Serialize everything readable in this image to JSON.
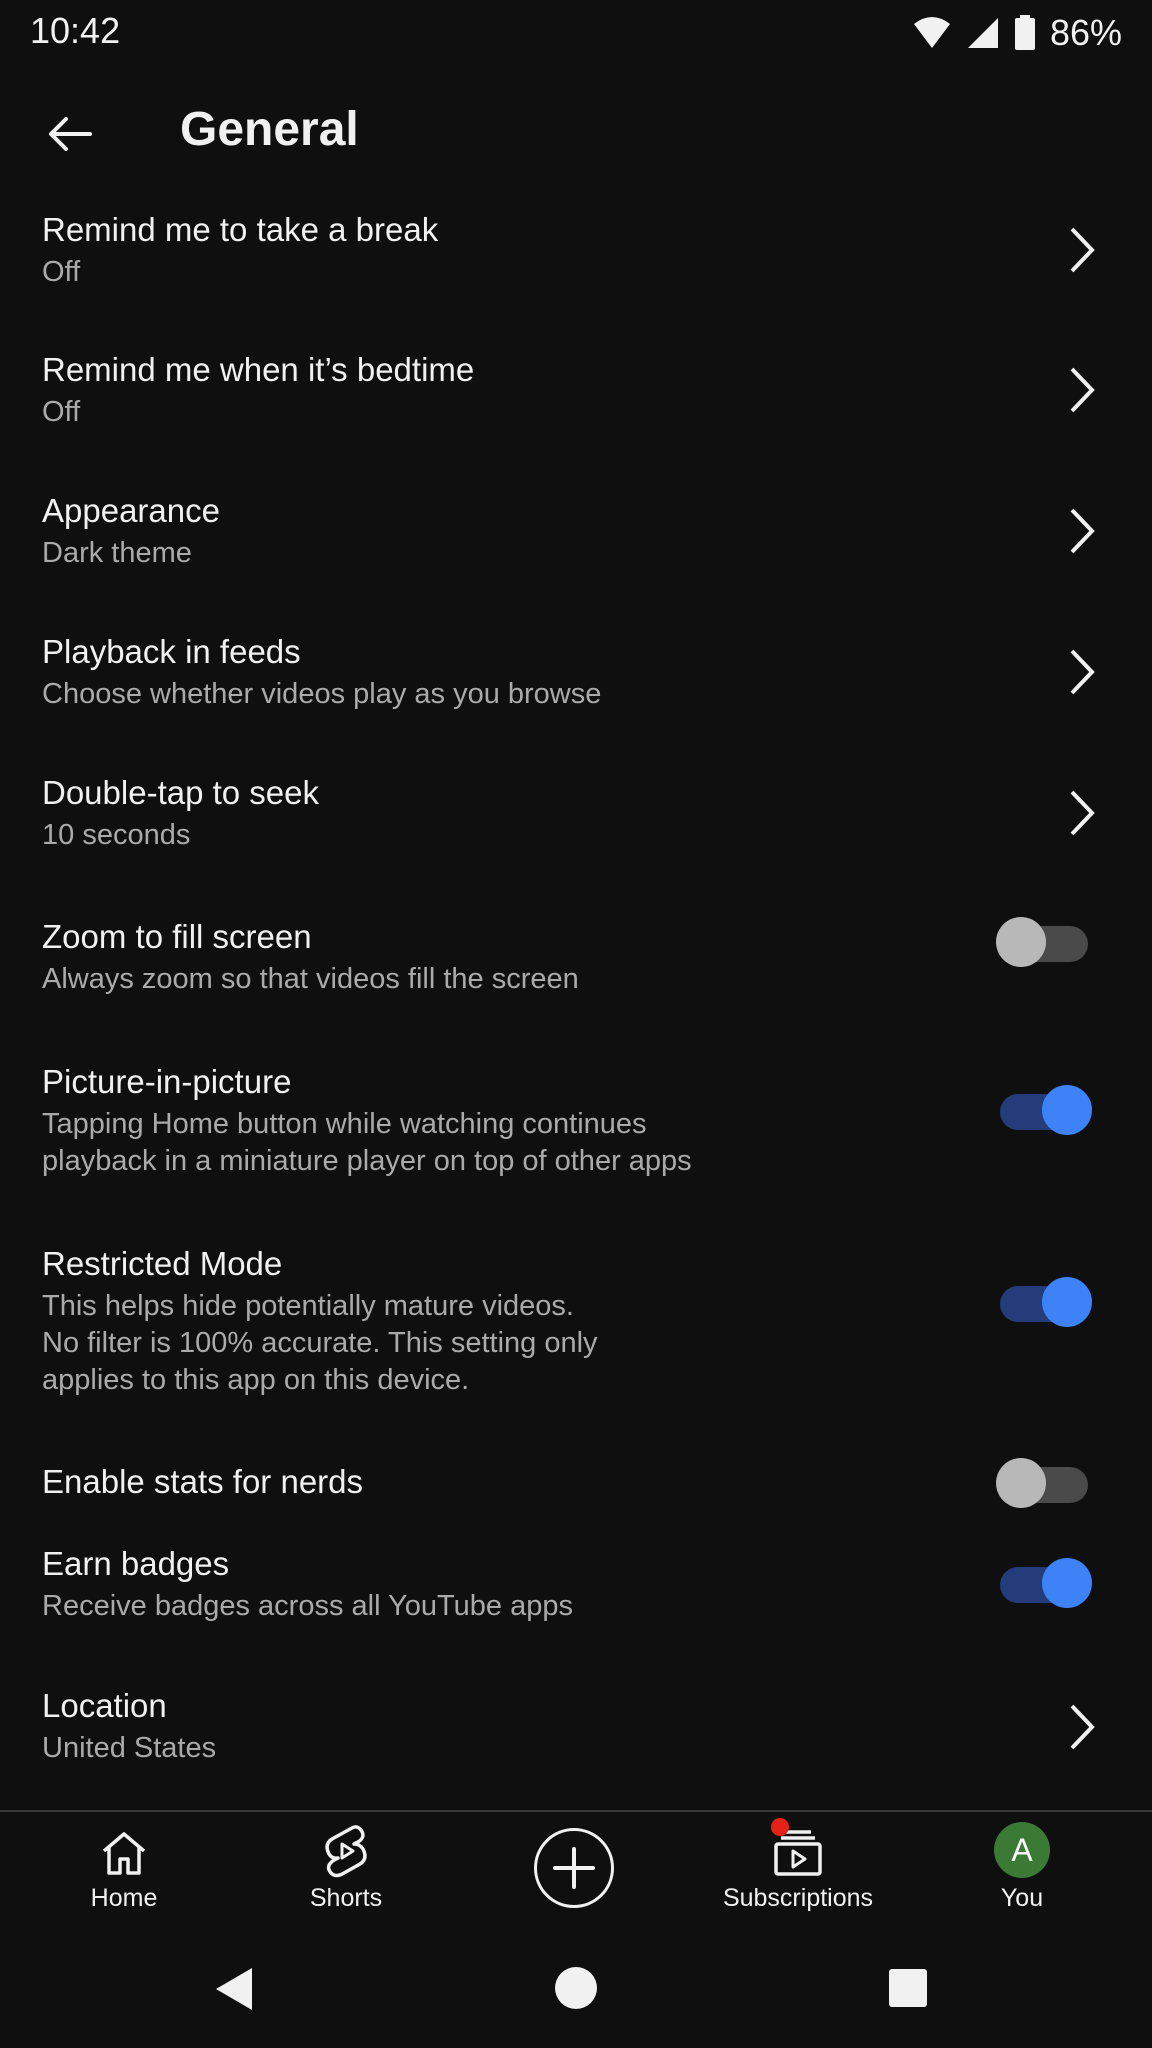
{
  "status": {
    "time": "10:42",
    "battery": "86%"
  },
  "header": {
    "title": "General"
  },
  "settings": [
    {
      "title": "Remind me to take a break",
      "subtitle": "Off",
      "control": "chevron"
    },
    {
      "title": "Remind me when it’s bedtime",
      "subtitle": "Off",
      "control": "chevron"
    },
    {
      "title": "Appearance",
      "subtitle": "Dark theme",
      "control": "chevron"
    },
    {
      "title": "Playback in feeds",
      "subtitle": "Choose whether videos play as you browse",
      "control": "chevron"
    },
    {
      "title": "Double-tap to seek",
      "subtitle": "10 seconds",
      "control": "chevron"
    },
    {
      "title": "Zoom to fill screen",
      "subtitle": "Always zoom so that videos fill the screen",
      "control": "toggle",
      "enabled": false
    },
    {
      "title": "Picture-in-picture",
      "subtitle_lines": [
        "Tapping Home button while watching continues",
        "playback in a miniature player on top of other apps"
      ],
      "control": "toggle",
      "enabled": true
    },
    {
      "title": "Restricted Mode",
      "subtitle_lines": [
        "This helps hide potentially mature videos.",
        "No filter is 100% accurate. This setting only",
        "applies to this app on this device."
      ],
      "control": "toggle",
      "enabled": true
    },
    {
      "title": "Enable stats for nerds",
      "control": "toggle",
      "enabled": false
    },
    {
      "title": "Earn badges",
      "subtitle": "Receive badges across all YouTube apps",
      "control": "toggle",
      "enabled": true
    },
    {
      "title": "Location",
      "subtitle": "United States",
      "control": "chevron"
    }
  ],
  "bottom_nav": {
    "home": "Home",
    "shorts": "Shorts",
    "subscriptions": "Subscriptions",
    "you": "You",
    "avatar_letter": "A"
  },
  "colors": {
    "background": "#0f0f0f",
    "toggle_on": "#3e82f7",
    "notification_dot": "#e62117",
    "avatar": "#3a7a35"
  },
  "icons": [
    "back-arrow-icon",
    "chevron-right-icon",
    "home-icon",
    "shorts-icon",
    "create-plus-icon",
    "subscriptions-icon",
    "wifi-icon",
    "signal-icon",
    "battery-icon"
  ]
}
